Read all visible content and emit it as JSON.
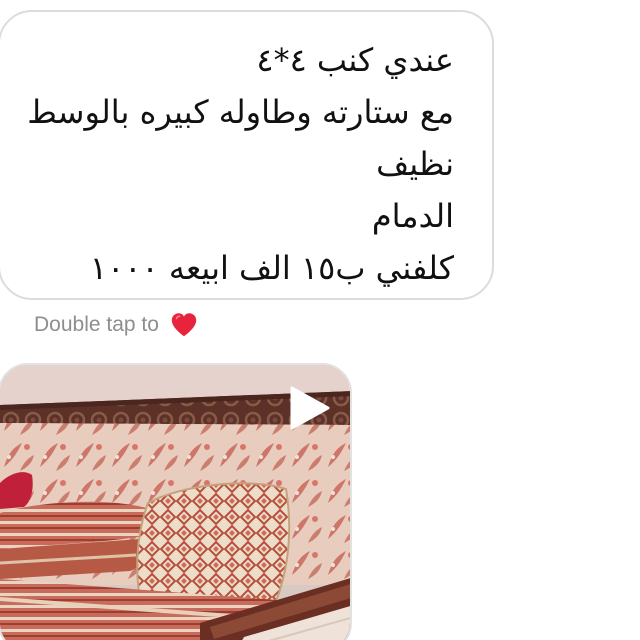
{
  "message": {
    "lines": [
      "عندي كنب ٤*٤",
      "مع ستارته وطاوله كبيره بالوسط",
      "نظيف",
      "الدمام",
      "كلفني ب١٥ الف ابيعه ١٠٠٠"
    ]
  },
  "hint": {
    "text": "Double tap to",
    "icon": "heart-icon",
    "heart_color": "#e8243c"
  },
  "video": {
    "thumbnail": "sofa-photo",
    "play_icon": "play-icon"
  },
  "colors": {
    "bubble_border": "#dcdcdc",
    "hint_text": "#8e8e8e"
  }
}
